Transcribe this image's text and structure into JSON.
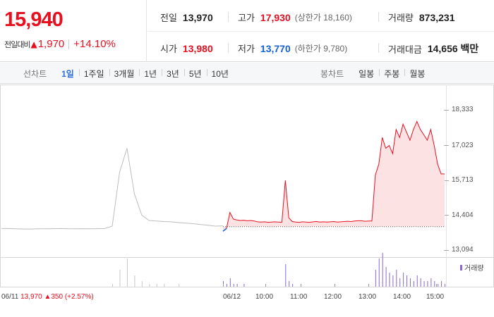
{
  "quote": {
    "price": "15,940",
    "change_label": "전일대비",
    "change_arrow": "▲",
    "change_value": "1,970",
    "change_percent": "+14.10%"
  },
  "stats": {
    "prev_close": {
      "label": "전일",
      "value": "13,970"
    },
    "high": {
      "label": "고가",
      "value": "17,930",
      "sub": "(상한가 18,160)"
    },
    "volume": {
      "label": "거래량",
      "value": "873,231"
    },
    "open": {
      "label": "시가",
      "value": "13,980"
    },
    "low": {
      "label": "저가",
      "value": "13,770",
      "sub": "(하한가 9,780)"
    },
    "trade_amount": {
      "label": "거래대금",
      "value": "14,656 백만"
    }
  },
  "toolbar": {
    "line_chart_title": "선차트",
    "periods": [
      "1일",
      "1주일",
      "3개월",
      "1년",
      "3년",
      "5년",
      "10년"
    ],
    "active_period": "1일",
    "candle_chart_title": "봉차트",
    "candle_periods": [
      "일봉",
      "주봉",
      "월봉"
    ]
  },
  "colors": {
    "up": "#e8101f",
    "down": "#1362d9",
    "accent": "#2f6ed5",
    "volume": "#8a67c9"
  },
  "chart_data": {
    "type": "line",
    "y_ticks": [
      "18,333",
      "17,023",
      "15,713",
      "14,404",
      "13,094"
    ],
    "ylim": [
      13094,
      18333
    ],
    "reference_line": 13970,
    "x_labels": [
      "06/11",
      "06/12",
      "10:00",
      "11:00",
      "12:00",
      "13:00",
      "14:00",
      "15:00"
    ],
    "volume_legend": "거래량",
    "prev_day_info": {
      "date": "06/11",
      "close": "13,970",
      "arrow": "▲",
      "change": "350",
      "pct": "(+2.57%)"
    },
    "prev_day_series": [
      13900,
      13900,
      13890,
      13880,
      13880,
      13890,
      13890,
      13895,
      13900,
      13890,
      13890,
      13895,
      13890,
      13895,
      13900,
      13990,
      16000,
      16900,
      15200,
      14400,
      14200,
      14180,
      14160,
      14150,
      14120,
      14100,
      14080,
      14050,
      14020,
      13990,
      14000
    ],
    "today_series": [
      13800,
      13900,
      14500,
      14250,
      14220,
      14200,
      14210,
      14190,
      14200,
      14180,
      14150,
      14140,
      14150,
      14130,
      14140,
      14150,
      14140,
      14130,
      15700,
      14300,
      14160,
      14140,
      14130,
      14150,
      14140,
      14130,
      14150,
      14160,
      14140,
      14150,
      14140,
      14150,
      14160,
      14140,
      14150,
      14160,
      14170,
      14160,
      14180,
      14190,
      14190,
      14170,
      14180,
      14180,
      15900,
      16300,
      17300,
      16900,
      17000,
      16700,
      17600,
      17300,
      17800,
      17500,
      17200,
      17600,
      17900,
      17600,
      17400,
      17200,
      17600,
      17000,
      16300,
      15940,
      15940
    ],
    "prev_volume": [
      0,
      0,
      0,
      0,
      0,
      0,
      0,
      0,
      0,
      0,
      0,
      0,
      0,
      0,
      0,
      1,
      6,
      10,
      4,
      2,
      1,
      1,
      1,
      0,
      1,
      0,
      0,
      0,
      0,
      0,
      0
    ],
    "today_volume": [
      2,
      1,
      3,
      1,
      1,
      0,
      1,
      0,
      0,
      0,
      0,
      0,
      0,
      0,
      0,
      0,
      0,
      0,
      8,
      2,
      1,
      0,
      0,
      0,
      0,
      0,
      0,
      0,
      0,
      0,
      0,
      0,
      0,
      0,
      0,
      0,
      0,
      0,
      0,
      0,
      0,
      0,
      0,
      0,
      6,
      10,
      12,
      7,
      5,
      4,
      6,
      3,
      5,
      4,
      3,
      2,
      4,
      3,
      2,
      2,
      3,
      2,
      1,
      2,
      1
    ]
  }
}
